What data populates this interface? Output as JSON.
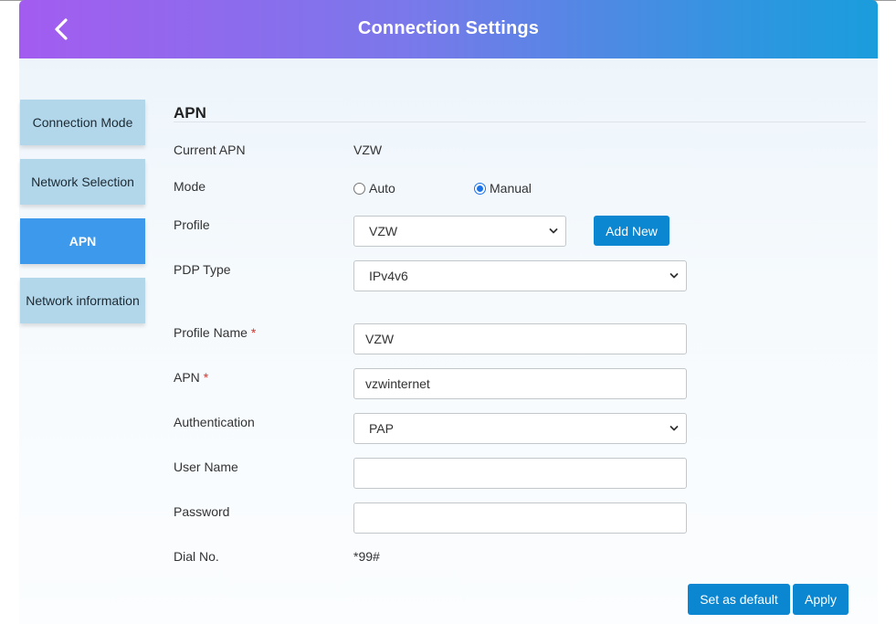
{
  "header": {
    "title": "Connection Settings"
  },
  "sidebar": {
    "items": [
      {
        "label": "Connection Mode"
      },
      {
        "label": "Network Selection"
      },
      {
        "label": "APN"
      },
      {
        "label": "Network information"
      }
    ],
    "active_index": 2
  },
  "apn": {
    "section_title": "APN",
    "current_apn": {
      "label": "Current APN",
      "value": "VZW"
    },
    "mode": {
      "label": "Mode",
      "options": [
        "Auto",
        "Manual"
      ],
      "selected": "Manual"
    },
    "profile": {
      "label": "Profile",
      "selected": "VZW",
      "add_new_label": "Add New"
    },
    "pdp_type": {
      "label": "PDP Type",
      "selected": "IPv4v6"
    },
    "profile_name": {
      "label": "Profile Name",
      "required_mark": "*",
      "value": "VZW"
    },
    "apn_field": {
      "label": "APN",
      "required_mark": "*",
      "value": "vzwinternet"
    },
    "authentication": {
      "label": "Authentication",
      "selected": "PAP"
    },
    "user_name": {
      "label": "User Name",
      "value": ""
    },
    "password": {
      "label": "Password",
      "value": ""
    },
    "dial_no": {
      "label": "Dial No.",
      "value": "*99#"
    }
  },
  "actions": {
    "set_default_label": "Set as default",
    "apply_label": "Apply"
  },
  "colors": {
    "header_gradient_start": "#a35cf0",
    "header_gradient_end": "#1a9ddc",
    "sidebar_bg": "#b3d7ea",
    "sidebar_active_bg": "#3d99eb",
    "button_bg": "#0b86d1",
    "required_mark": "#d9342b"
  },
  "icons": {
    "back": "chevron-left-icon",
    "select_arrow": "chevron-down-icon"
  }
}
